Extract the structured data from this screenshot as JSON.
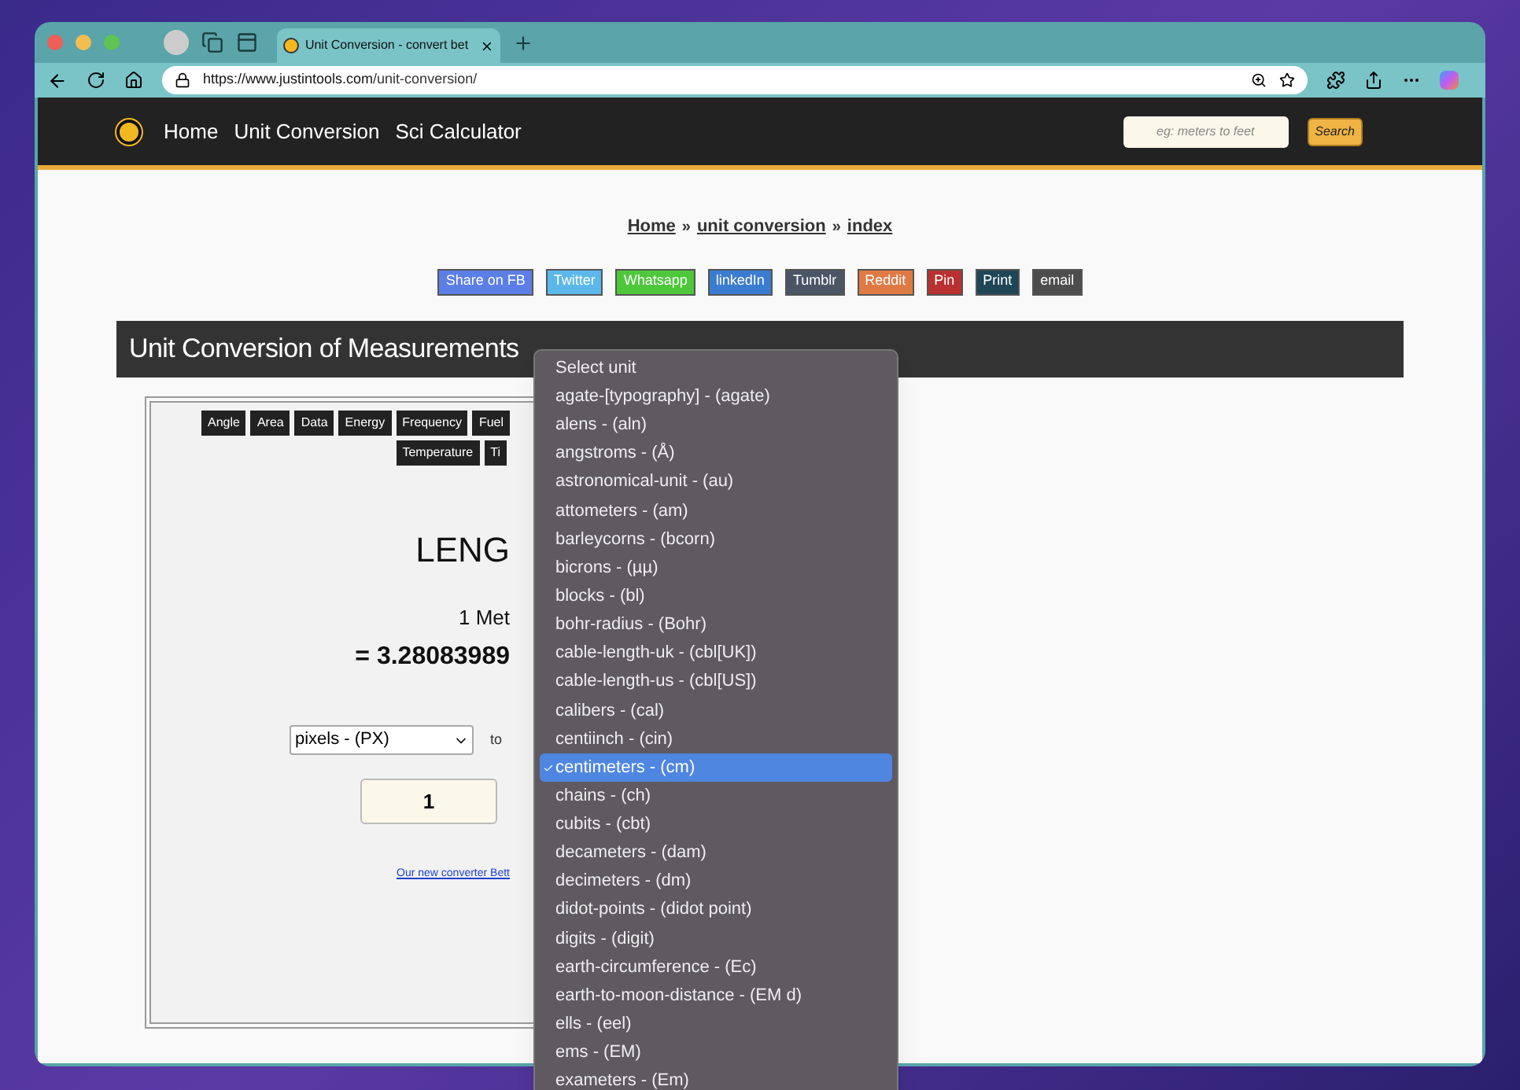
{
  "browser": {
    "tab_title": "Unit Conversion - convert bet",
    "url_host": "https://www.justintools.com",
    "url_path": "/unit-conversion/"
  },
  "site_nav": [
    "Home",
    "Unit Conversion",
    "Sci Calculator"
  ],
  "search": {
    "placeholder": "eg: meters to feet",
    "button": "Search"
  },
  "breadcrumb": [
    {
      "kind": "link",
      "text": "Home"
    },
    {
      "kind": "sep",
      "text": "»"
    },
    {
      "kind": "link",
      "text": "unit conversion"
    },
    {
      "kind": "sep",
      "text": "»"
    },
    {
      "kind": "link",
      "text": "index"
    }
  ],
  "share_buttons": [
    {
      "label": "Share on FB",
      "color": "#5b7fe6"
    },
    {
      "label": "Twitter",
      "color": "#5cb8ea"
    },
    {
      "label": "Whatsapp",
      "color": "#4ec73a"
    },
    {
      "label": "linkedIn",
      "color": "#3b7cd0"
    },
    {
      "label": "Tumblr",
      "color": "#4a5566"
    },
    {
      "label": "Reddit",
      "color": "#e07a45"
    },
    {
      "label": "Pin",
      "color": "#b8302f"
    },
    {
      "label": "Print",
      "color": "#1f4656"
    },
    {
      "label": "email",
      "color": "#4d4d4d"
    }
  ],
  "heading": "Unit Conversion of Measurements",
  "categories": [
    [
      "Angle",
      "Area",
      "Data",
      "Energy",
      "Frequency",
      "Fuel"
    ],
    [
      "Temperature",
      "Ti"
    ]
  ],
  "converter": {
    "title": "LENG",
    "line": "1 Met",
    "result": "= 3.28083989",
    "from_unit": "pixels - (PX)",
    "to_label": "to",
    "input_value": "1",
    "link": "Our new converter Bett"
  },
  "dropdown": [
    {
      "label": "Select unit",
      "selected": false
    },
    {
      "label": "agate-[typography] - (agate)",
      "selected": false
    },
    {
      "label": "alens - (aln)",
      "selected": false
    },
    {
      "label": "angstroms - (Å)",
      "selected": false
    },
    {
      "label": "astronomical-unit - (au)",
      "selected": false
    },
    {
      "label": "attometers - (am)",
      "selected": false
    },
    {
      "label": "barleycorns - (bcorn)",
      "selected": false
    },
    {
      "label": "bicrons - (µµ)",
      "selected": false
    },
    {
      "label": "blocks - (bl)",
      "selected": false
    },
    {
      "label": "bohr-radius - (Bohr)",
      "selected": false
    },
    {
      "label": "cable-length-uk - (cbl[UK])",
      "selected": false
    },
    {
      "label": "cable-length-us - (cbl[US])",
      "selected": false
    },
    {
      "label": "calibers - (cal)",
      "selected": false
    },
    {
      "label": "centiinch - (cin)",
      "selected": false
    },
    {
      "label": "centimeters - (cm)",
      "selected": true
    },
    {
      "label": "chains - (ch)",
      "selected": false
    },
    {
      "label": "cubits - (cbt)",
      "selected": false
    },
    {
      "label": "decameters - (dam)",
      "selected": false
    },
    {
      "label": "decimeters - (dm)",
      "selected": false
    },
    {
      "label": "didot-points - (didot point)",
      "selected": false
    },
    {
      "label": "digits - (digit)",
      "selected": false
    },
    {
      "label": "earth-circumference - (Ec)",
      "selected": false
    },
    {
      "label": "earth-to-moon-distance - (EM d)",
      "selected": false
    },
    {
      "label": "ells - (eel)",
      "selected": false
    },
    {
      "label": "ems - (EM)",
      "selected": false
    },
    {
      "label": "exameters - (Em)",
      "selected": false
    }
  ]
}
